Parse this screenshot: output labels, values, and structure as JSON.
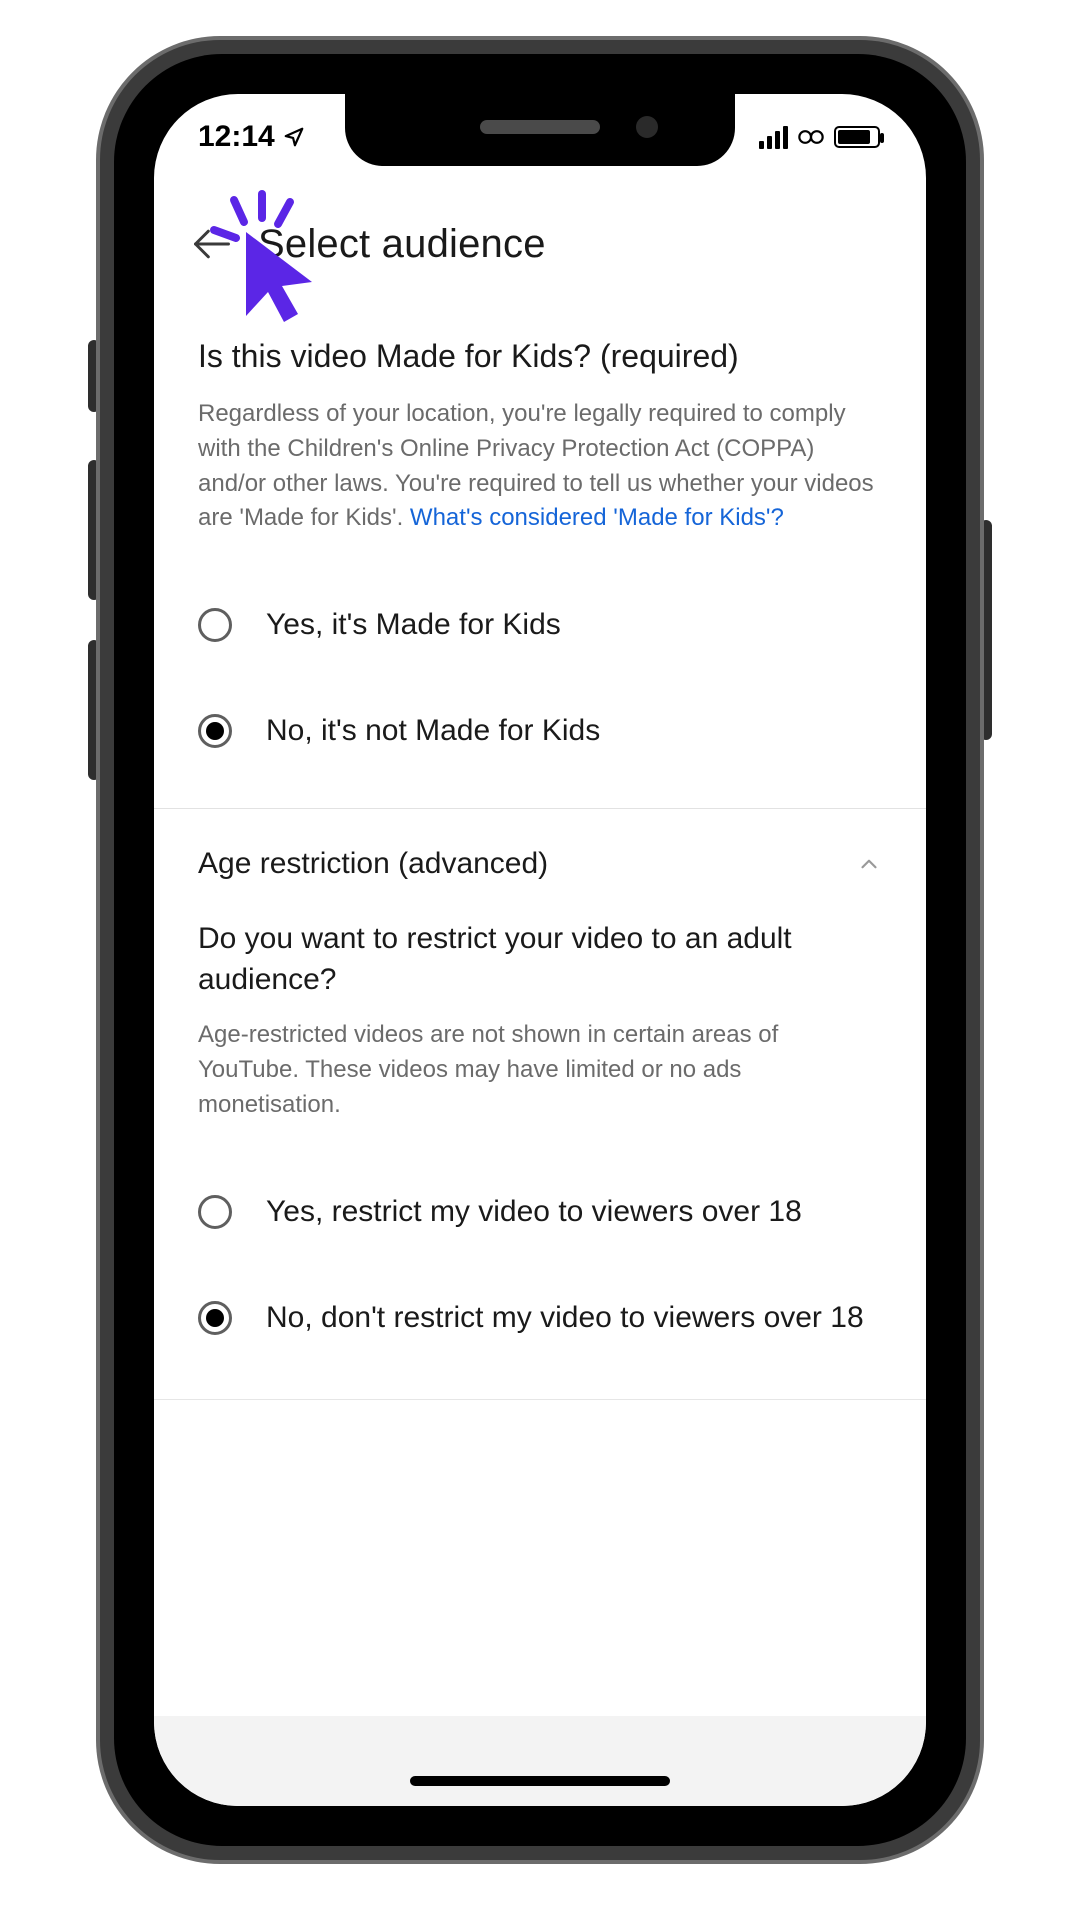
{
  "status": {
    "time": "12:14"
  },
  "header": {
    "title": "Select audience"
  },
  "section1": {
    "question": "Is this video Made for Kids? (required)",
    "description": "Regardless of your location, you're legally required to comply with the Children's Online Privacy Protection Act (COPPA) and/or other laws. You're required to tell us whether your videos are 'Made for Kids'. ",
    "link": "What's considered 'Made for Kids'?",
    "options": [
      {
        "label": "Yes, it's Made for Kids",
        "selected": false
      },
      {
        "label": "No, it's not Made for Kids",
        "selected": true
      }
    ]
  },
  "section2": {
    "title": "Age restriction (advanced)",
    "expanded": true,
    "question": "Do you want to restrict your video to an adult audience?",
    "description": "Age-restricted videos are not shown in certain areas of YouTube. These videos may have limited or no ads monetisation.",
    "options": [
      {
        "label": "Yes, restrict my video to viewers over 18",
        "selected": false
      },
      {
        "label": "No, don't restrict my video to viewers over 18",
        "selected": true
      }
    ]
  },
  "cursor_color": "#5b26e6"
}
